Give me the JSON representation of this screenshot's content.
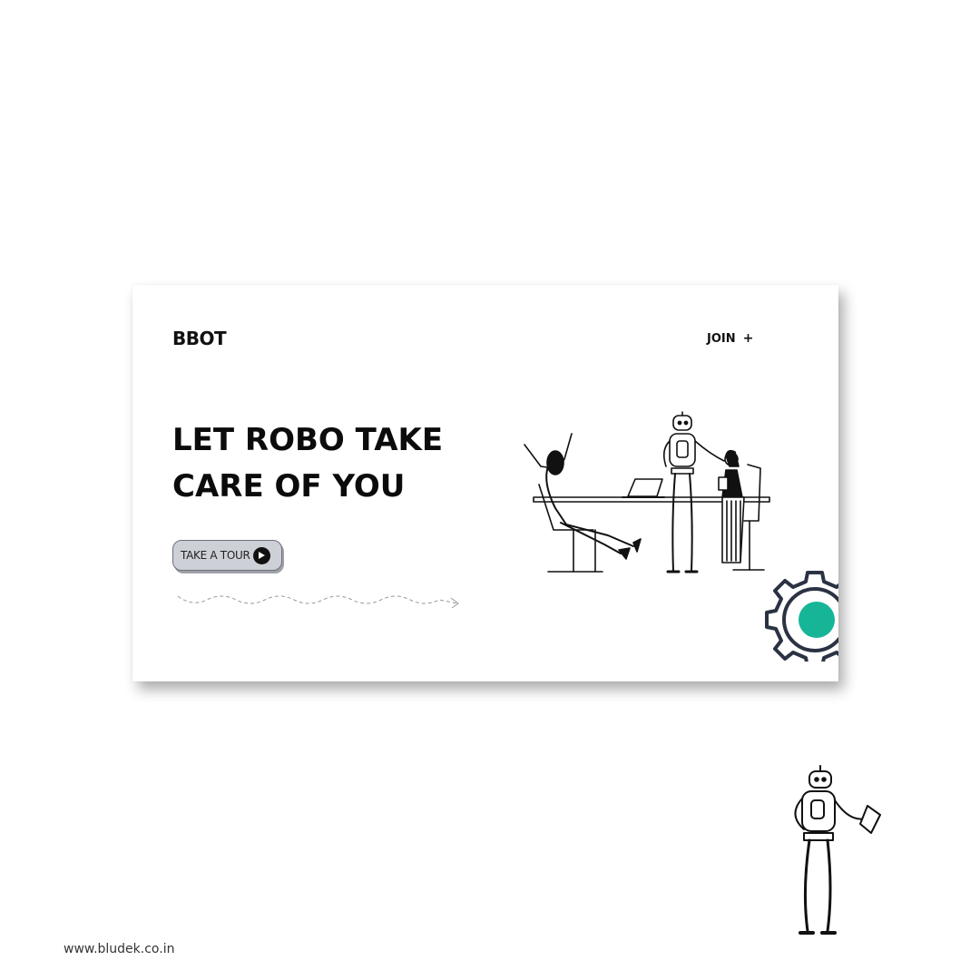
{
  "header": {
    "logo": "BBOT",
    "join_label": "JOIN",
    "join_icon": "+"
  },
  "hero": {
    "headline_line1": "LET ROBO TAKE",
    "headline_line2": "CARE OF YOU",
    "cta_label": "TAKE A TOUR",
    "cta_icon": "play-icon"
  },
  "colors": {
    "accent": "#16b598",
    "gear_outline": "#2b3243",
    "button_bg": "#cdd0d6"
  },
  "footer": {
    "website": "www.bludek.co.in"
  }
}
